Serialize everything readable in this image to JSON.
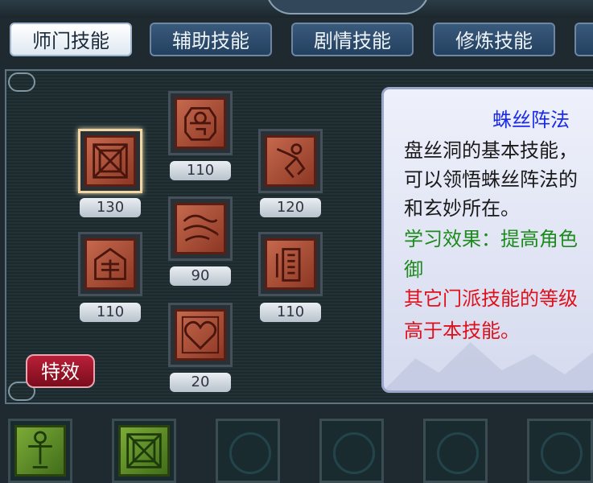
{
  "tabs": [
    {
      "label": "师门技能",
      "active": true
    },
    {
      "label": "辅助技能",
      "active": false
    },
    {
      "label": "剧情技能",
      "active": false
    },
    {
      "label": "修炼技能",
      "active": false
    }
  ],
  "skills": [
    {
      "level": "130",
      "icon": "square-maze-icon",
      "selected": true
    },
    {
      "level": "110",
      "icon": "lantern-icon",
      "selected": false
    },
    {
      "level": "120",
      "icon": "running-figure-icon",
      "selected": false
    },
    {
      "level": "90",
      "icon": "web-swirl-icon",
      "selected": false
    },
    {
      "level": "110",
      "icon": "house-icon",
      "selected": false
    },
    {
      "level": "110",
      "icon": "scroll-icon",
      "selected": false
    },
    {
      "level": "20",
      "icon": "heart-icon",
      "selected": false
    }
  ],
  "effects_button": "特效",
  "detail": {
    "title": "蛛丝阵法",
    "lines": [
      {
        "text": "盘丝洞的基本技能，",
        "color": "dark"
      },
      {
        "text": "可以领悟蛛丝阵法的",
        "color": "dark"
      },
      {
        "text": "和玄妙所在。",
        "color": "dark"
      },
      {
        "text": "学习效果：提高角色",
        "color": "green"
      },
      {
        "text": "御",
        "color": "green"
      },
      {
        "text": "其它门派技能的等级",
        "color": "red"
      },
      {
        "text": "高于本技能。",
        "color": "red"
      }
    ]
  },
  "quickbar": [
    {
      "icon": "green-figure-icon",
      "filled": true
    },
    {
      "icon": "green-maze-icon",
      "filled": true
    },
    {
      "icon": "empty-slot-emblem-icon",
      "filled": false
    },
    {
      "icon": "empty-slot-emblem-icon",
      "filled": false
    },
    {
      "icon": "empty-slot-emblem-icon",
      "filled": false
    },
    {
      "icon": "empty-slot-emblem-icon",
      "filled": false
    }
  ]
}
